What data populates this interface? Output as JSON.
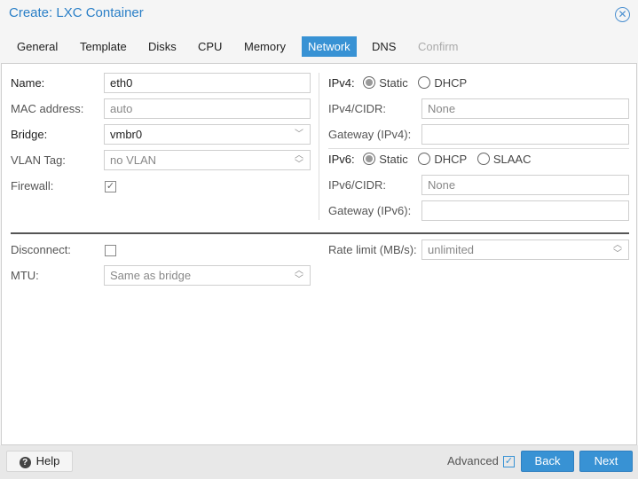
{
  "window": {
    "title": "Create: LXC Container",
    "close_icon": "close-circle-icon"
  },
  "tabs": [
    {
      "label": "General"
    },
    {
      "label": "Template"
    },
    {
      "label": "Disks"
    },
    {
      "label": "CPU"
    },
    {
      "label": "Memory"
    },
    {
      "label": "Network",
      "active": true
    },
    {
      "label": "DNS"
    },
    {
      "label": "Confirm",
      "disabled": true
    }
  ],
  "left": {
    "name_label": "Name:",
    "name_value": "eth0",
    "mac_label": "MAC address:",
    "mac_placeholder": "auto",
    "bridge_label": "Bridge:",
    "bridge_value": "vmbr0",
    "vlan_label": "VLAN Tag:",
    "vlan_placeholder": "no VLAN",
    "firewall_label": "Firewall:",
    "firewall_checked": true,
    "disconnect_label": "Disconnect:",
    "disconnect_checked": false,
    "mtu_label": "MTU:",
    "mtu_placeholder": "Same as bridge"
  },
  "right": {
    "ipv4_label": "IPv4:",
    "ipv4_options": [
      "Static",
      "DHCP"
    ],
    "ipv4_selected": "Static",
    "ipv4cidr_label": "IPv4/CIDR:",
    "ipv4cidr_placeholder": "None",
    "gw4_label": "Gateway (IPv4):",
    "ipv6_label": "IPv6:",
    "ipv6_options": [
      "Static",
      "DHCP",
      "SLAAC"
    ],
    "ipv6_selected": "Static",
    "ipv6cidr_label": "IPv6/CIDR:",
    "ipv6cidr_placeholder": "None",
    "gw6_label": "Gateway (IPv6):",
    "rate_label": "Rate limit (MB/s):",
    "rate_placeholder": "unlimited"
  },
  "footer": {
    "help": "Help",
    "advanced": "Advanced",
    "advanced_checked": true,
    "back": "Back",
    "next": "Next"
  },
  "colors": {
    "accent": "#3892d4"
  }
}
